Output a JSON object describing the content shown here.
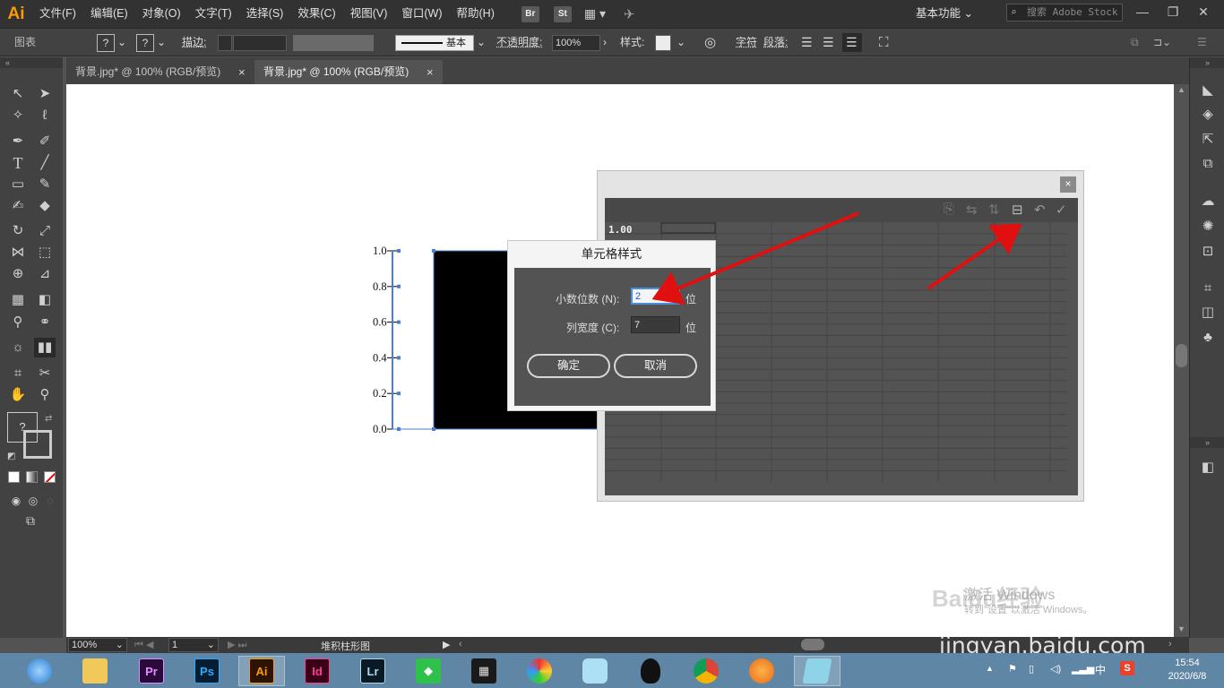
{
  "app": {
    "logo": "Ai",
    "menu": [
      "文件(F)",
      "编辑(E)",
      "对象(O)",
      "文字(T)",
      "选择(S)",
      "效果(C)",
      "视图(V)",
      "窗口(W)",
      "帮助(H)"
    ],
    "bridge_label": "Br",
    "stock_label": "St",
    "workspace_label": "基本功能",
    "search_placeholder": "搜索 Adobe Stock"
  },
  "control_bar": {
    "object_type": "图表",
    "fill_q": "?",
    "stroke_q": "?",
    "stroke_label": "描边:",
    "brush_label": "基本",
    "opacity_label": "不透明度:",
    "opacity_value": "100%",
    "style_label": "样式:",
    "char_label": "字符",
    "para_label": "段落:"
  },
  "tabs": [
    {
      "label": "背景.jpg* @ 100% (RGB/预览)",
      "active": false
    },
    {
      "label": "背景.jpg* @ 100% (RGB/预览)",
      "active": true
    }
  ],
  "chart_data": {
    "type": "bar",
    "title": "",
    "xlabel": "",
    "ylabel": "",
    "categories": [
      ""
    ],
    "values": [
      1.0
    ],
    "ylim": [
      0,
      1.0
    ],
    "yticks": [
      "1.0",
      "0.8",
      "0.6",
      "0.4",
      "0.2",
      "0.0"
    ],
    "bar_color": "#000000",
    "selection_color": "#4a7fd4"
  },
  "graph_data_window": {
    "first_cell_value": "1.00",
    "close_label": "×"
  },
  "cell_style_dialog": {
    "title": "单元格样式",
    "decimals_label": "小数位数 (N):",
    "decimals_value": "2",
    "decimals_unit": "位",
    "column_width_label": "列宽度 (C):",
    "column_width_value": "7",
    "column_width_unit": "位",
    "ok_label": "确定",
    "cancel_label": "取消"
  },
  "status_bar": {
    "zoom": "100%",
    "page": "1",
    "tool_name": "堆积柱形图"
  },
  "watermark": {
    "activate_line1": "激活 Windows",
    "activate_line2": "转到\"设置\"以激活 Windows。",
    "baidu_text": "jingyan.baidu.com",
    "baidu_brand": "Baidu经验"
  },
  "taskbar": {
    "apps": [
      "Pr",
      "Ps",
      "Ai",
      "Id",
      "Lr"
    ],
    "ime": "中",
    "time": "15:54",
    "date": "2020/6/8"
  },
  "colors": {
    "arrow": "#e01010",
    "ui_dark": "#424242",
    "ui_mid": "#535353",
    "accent_ai": "#ff9a00"
  }
}
